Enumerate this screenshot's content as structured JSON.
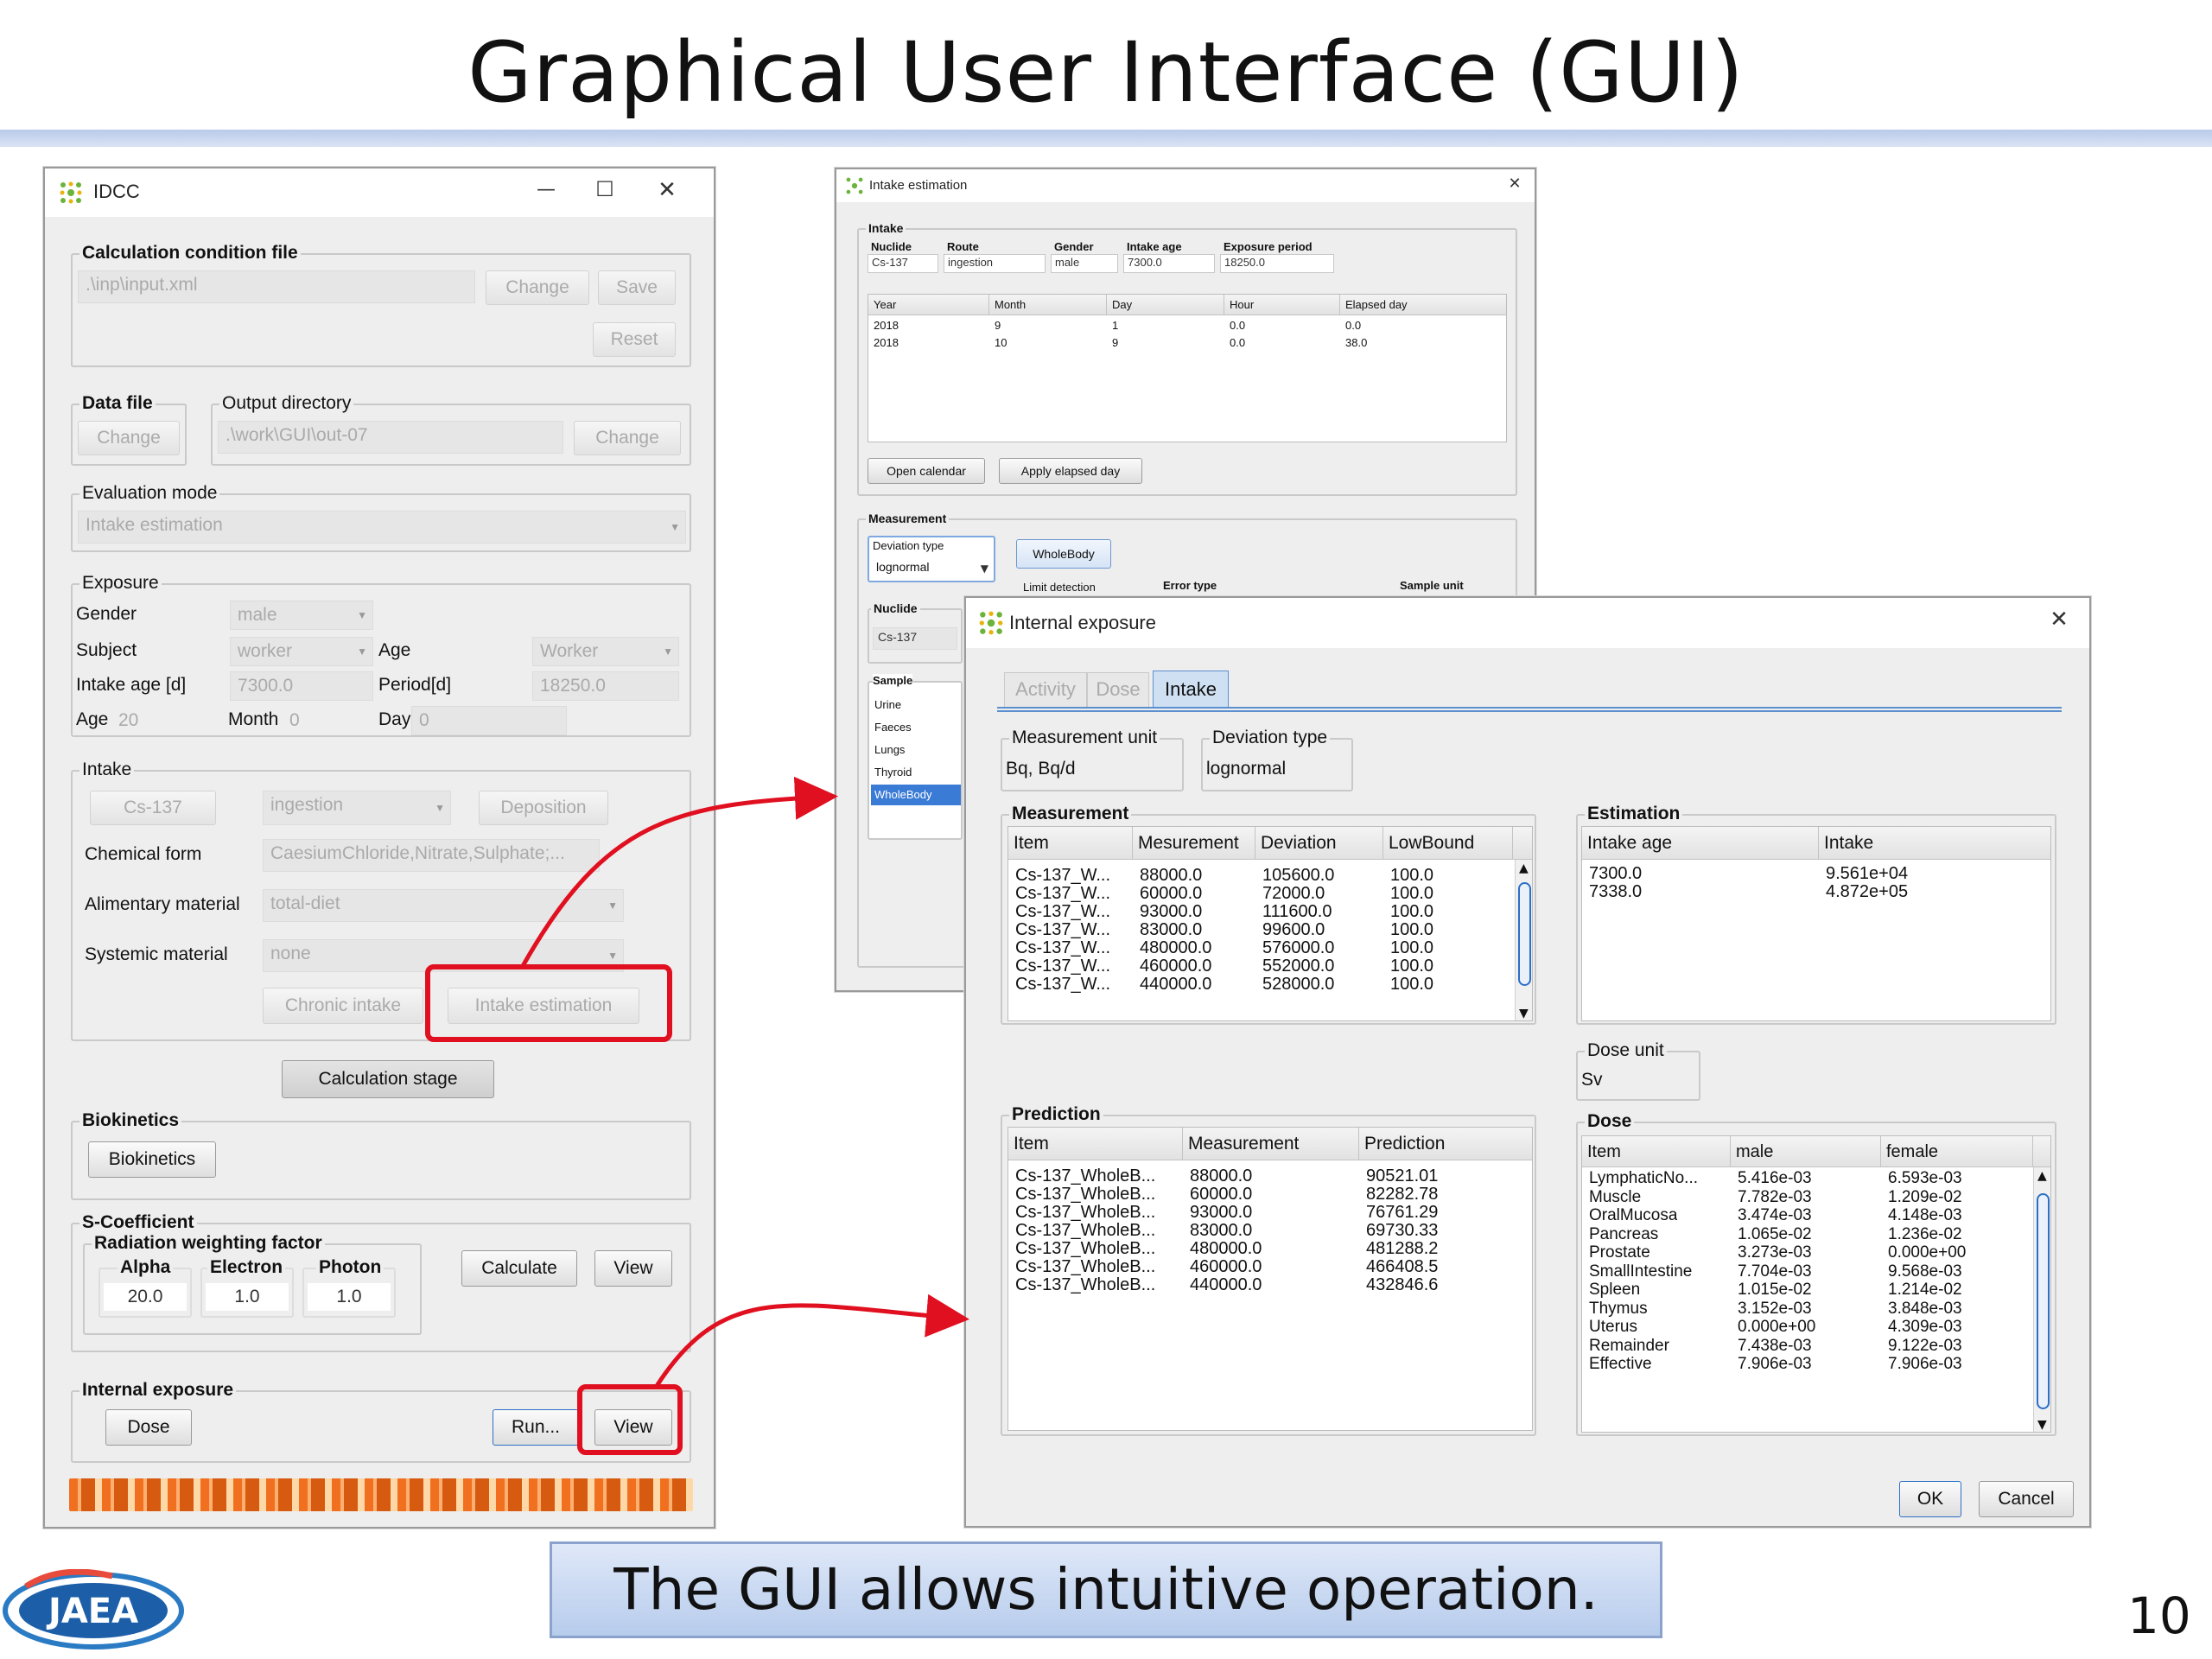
{
  "slide": {
    "title": "Graphical User Interface (GUI)",
    "caption": "The GUI allows intuitive operation.",
    "page_number": "10",
    "logo_text": "JAEA",
    "colors": {
      "accent_red": "#e01020",
      "title_strip": "#b9cbea",
      "caption_bg": "#cbd9f1"
    }
  },
  "idcc": {
    "title": "IDCC",
    "controls": {
      "minimize": "—",
      "maximize": "☐",
      "close": "✕"
    },
    "calc_file": {
      "group": "Calculation condition file",
      "path": ".\\inp\\input.xml",
      "change": "Change",
      "save": "Save",
      "reset": "Reset"
    },
    "data_file": {
      "group": "Data file",
      "change": "Change"
    },
    "output_dir": {
      "group": "Output directory",
      "path": ".\\work\\GUI\\out-07",
      "change": "Change"
    },
    "eval_mode": {
      "group": "Evaluation mode",
      "value": "Intake estimation"
    },
    "exposure": {
      "group": "Exposure",
      "gender_label": "Gender",
      "gender_value": "male",
      "subject_label": "Subject",
      "subject_value": "worker",
      "age_label": "Age",
      "age_value": "Worker",
      "intake_age_label": "Intake age [d]",
      "intake_age_value": "7300.0",
      "period_label": "Period[d]",
      "period_value": "18250.0",
      "age2_label": "Age",
      "age2_value": "20",
      "month_label": "Month",
      "month_value": "0",
      "day_label": "Day",
      "day_value": "0"
    },
    "intake": {
      "group": "Intake",
      "nuclide": "Cs-137",
      "route": "ingestion",
      "deposition": "Deposition",
      "chem_label": "Chemical form",
      "chem_value": "CaesiumChloride,Nitrate,Sulphate;...",
      "alim_label": "Alimentary material",
      "alim_value": "total-diet",
      "sys_label": "Systemic material",
      "sys_value": "none",
      "chronic": "Chronic intake",
      "intake_est": "Intake estimation"
    },
    "calc_stage": "Calculation stage",
    "biokinetics": {
      "group": "Biokinetics",
      "button": "Biokinetics"
    },
    "scoef": {
      "group": "S-Coefficient",
      "rwf": "Radiation weighting factor",
      "alpha_label": "Alpha",
      "alpha_value": "20.0",
      "electron_label": "Electron",
      "electron_value": "1.0",
      "photon_label": "Photon",
      "photon_value": "1.0",
      "calculate": "Calculate",
      "view": "View"
    },
    "internal": {
      "group": "Internal exposure",
      "dose": "Dose",
      "run": "Run...",
      "view": "View"
    }
  },
  "intake_window": {
    "title": "Intake estimation",
    "close": "✕",
    "intake_group": "Intake",
    "fields": [
      {
        "label": "Nuclide",
        "value": "Cs-137"
      },
      {
        "label": "Route",
        "value": "ingestion"
      },
      {
        "label": "Gender",
        "value": "male"
      },
      {
        "label": "Intake age",
        "value": "7300.0"
      },
      {
        "label": "Exposure period",
        "value": "18250.0"
      }
    ],
    "date_table": {
      "headers": [
        "Year",
        "Month",
        "Day",
        "Hour",
        "Elapsed day"
      ],
      "rows": [
        [
          "2018",
          "9",
          "1",
          "0.0",
          "0.0"
        ],
        [
          "2018",
          "10",
          "9",
          "0.0",
          "38.0"
        ]
      ]
    },
    "open_calendar": "Open calendar",
    "apply_elapsed": "Apply elapsed day",
    "measurement_group": "Measurement",
    "deviation_type_label": "Deviation type",
    "deviation_type_value": "lognormal",
    "wholebody_btn": "WholeBody",
    "limit_detection": "Limit detection",
    "error_type": "Error type",
    "sample_unit": "Sample unit",
    "nuclide_label": "Nuclide",
    "nuclide_value": "Cs-137",
    "sample_label": "Sample",
    "samples": [
      "Urine",
      "Faeces",
      "Lungs",
      "Thyroid",
      "WholeBody"
    ]
  },
  "internal_window": {
    "title": "Internal exposure",
    "close": "✕",
    "tabs": [
      "Activity",
      "Dose",
      "Intake"
    ],
    "meas_unit": {
      "group": "Measurement unit",
      "value": "Bq, Bq/d"
    },
    "dev_type": {
      "group": "Deviation type",
      "value": "lognormal"
    },
    "measurement": {
      "group": "Measurement",
      "headers": [
        "Item",
        "Mesurement",
        "Deviation",
        "LowBound"
      ],
      "rows": [
        [
          "Cs-137_W...",
          "88000.0",
          "105600.0",
          "100.0"
        ],
        [
          "Cs-137_W...",
          "60000.0",
          "72000.0",
          "100.0"
        ],
        [
          "Cs-137_W...",
          "93000.0",
          "111600.0",
          "100.0"
        ],
        [
          "Cs-137_W...",
          "83000.0",
          "99600.0",
          "100.0"
        ],
        [
          "Cs-137_W...",
          "480000.0",
          "576000.0",
          "100.0"
        ],
        [
          "Cs-137_W...",
          "460000.0",
          "552000.0",
          "100.0"
        ],
        [
          "Cs-137_W...",
          "440000.0",
          "528000.0",
          "100.0"
        ]
      ]
    },
    "estimation": {
      "group": "Estimation",
      "headers": [
        "Intake age",
        "Intake"
      ],
      "rows": [
        [
          "7300.0",
          "9.561e+04"
        ],
        [
          "7338.0",
          "4.872e+05"
        ]
      ]
    },
    "dose_unit": {
      "group": "Dose unit",
      "value": "Sv"
    },
    "prediction": {
      "group": "Prediction",
      "headers": [
        "Item",
        "Measurement",
        "Prediction"
      ],
      "rows": [
        [
          "Cs-137_WholeB...",
          "88000.0",
          "90521.01"
        ],
        [
          "Cs-137_WholeB...",
          "60000.0",
          "82282.78"
        ],
        [
          "Cs-137_WholeB...",
          "93000.0",
          "76761.29"
        ],
        [
          "Cs-137_WholeB...",
          "83000.0",
          "69730.33"
        ],
        [
          "Cs-137_WholeB...",
          "480000.0",
          "481288.2"
        ],
        [
          "Cs-137_WholeB...",
          "460000.0",
          "466408.5"
        ],
        [
          "Cs-137_WholeB...",
          "440000.0",
          "432846.6"
        ]
      ]
    },
    "dose": {
      "group": "Dose",
      "headers": [
        "Item",
        "male",
        "female"
      ],
      "rows": [
        [
          "LymphaticNo...",
          "5.416e-03",
          "6.593e-03"
        ],
        [
          "Muscle",
          "7.782e-03",
          "1.209e-02"
        ],
        [
          "OralMucosa",
          "3.474e-03",
          "4.148e-03"
        ],
        [
          "Pancreas",
          "1.065e-02",
          "1.236e-02"
        ],
        [
          "Prostate",
          "3.273e-03",
          "0.000e+00"
        ],
        [
          "SmallIntestine",
          "7.704e-03",
          "9.568e-03"
        ],
        [
          "Spleen",
          "1.015e-02",
          "1.214e-02"
        ],
        [
          "Thymus",
          "3.152e-03",
          "3.848e-03"
        ],
        [
          "Uterus",
          "0.000e+00",
          "4.309e-03"
        ],
        [
          "Remainder",
          "7.438e-03",
          "9.122e-03"
        ],
        [
          "Effective",
          "7.906e-03",
          "7.906e-03"
        ]
      ]
    },
    "ok": "OK",
    "cancel": "Cancel"
  }
}
